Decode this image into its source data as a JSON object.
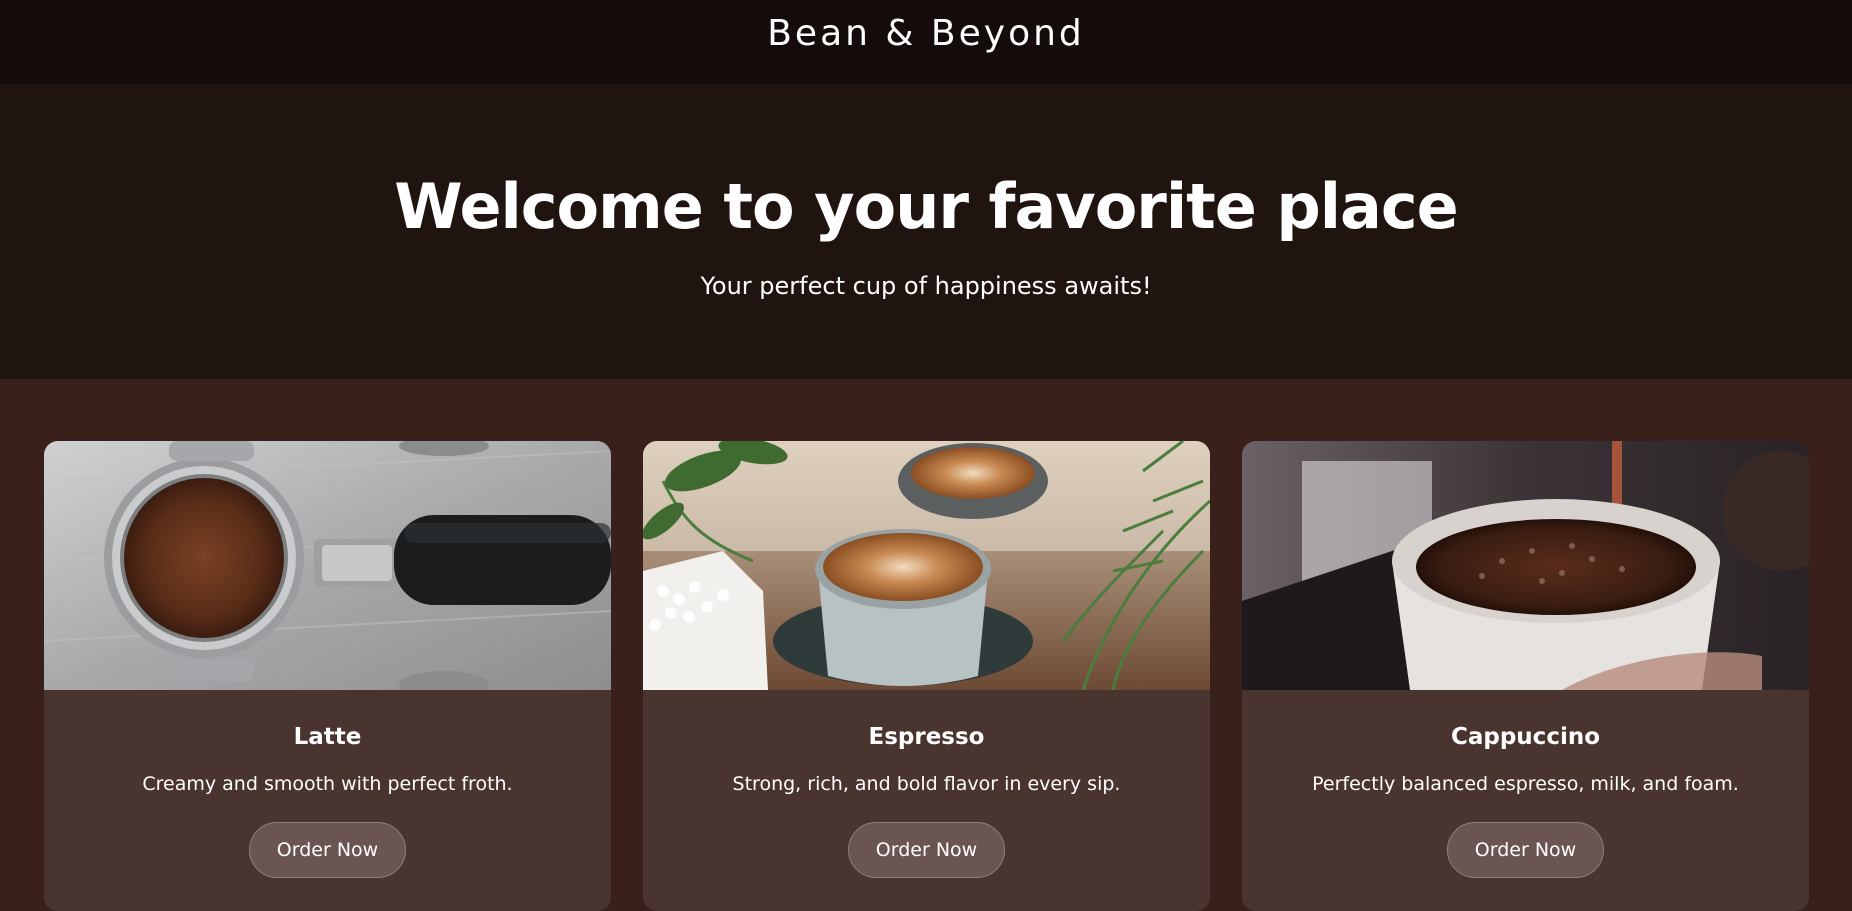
{
  "header": {
    "brand": "Bean & Beyond"
  },
  "hero": {
    "title": "Welcome to your favorite place",
    "subtitle": "Your perfect cup of happiness awaits!"
  },
  "menu": {
    "items": [
      {
        "name": "Latte",
        "description": "Creamy and smooth with perfect froth.",
        "button_label": "Order Now",
        "image": "portafilter-with-ground-coffee"
      },
      {
        "name": "Espresso",
        "description": "Strong, rich, and bold flavor in every sip.",
        "button_label": "Order Now",
        "image": "latte-art-cups-with-plants"
      },
      {
        "name": "Cappuccino",
        "description": "Perfectly balanced espresso, milk, and foam.",
        "button_label": "Order Now",
        "image": "coffee-pouring-into-cup"
      }
    ]
  },
  "colors": {
    "topbar": "#140c0a",
    "hero": "#201411",
    "section": "#3a201b",
    "card": "#4a342f",
    "button": "#6a5552"
  }
}
